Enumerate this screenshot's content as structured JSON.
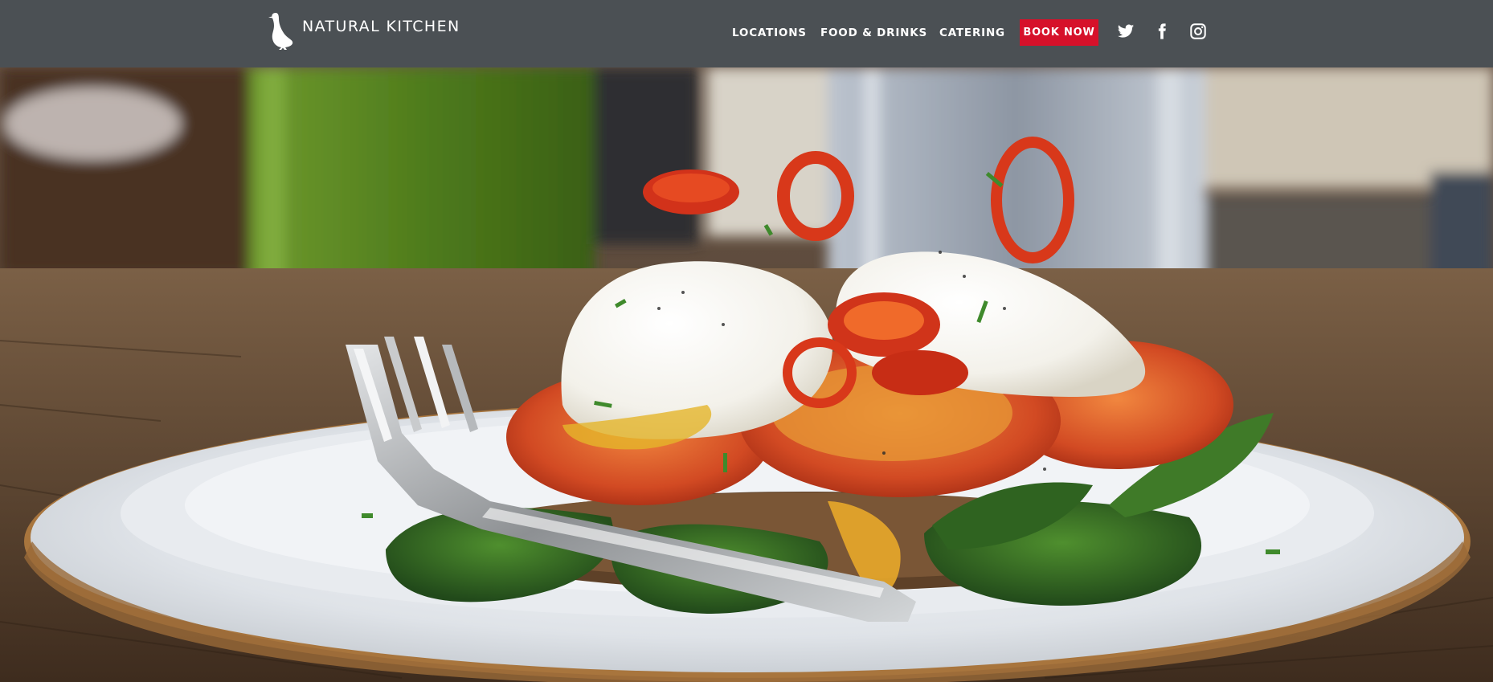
{
  "brand": {
    "name": "NATURAL KITCHEN",
    "logo_icon": "duck-icon",
    "header_color": "#4b5054"
  },
  "nav": {
    "items": [
      {
        "label": "LOCATIONS"
      },
      {
        "label": "FOOD & DRINKS"
      },
      {
        "label": "CATERING"
      }
    ],
    "cta": {
      "label": "BOOK NOW",
      "color": "#d6112a"
    },
    "social": [
      {
        "name": "twitter-icon"
      },
      {
        "name": "facebook-icon"
      },
      {
        "name": "instagram-icon"
      }
    ]
  },
  "hero": {
    "image": "poached-eggs-dish-photo"
  }
}
